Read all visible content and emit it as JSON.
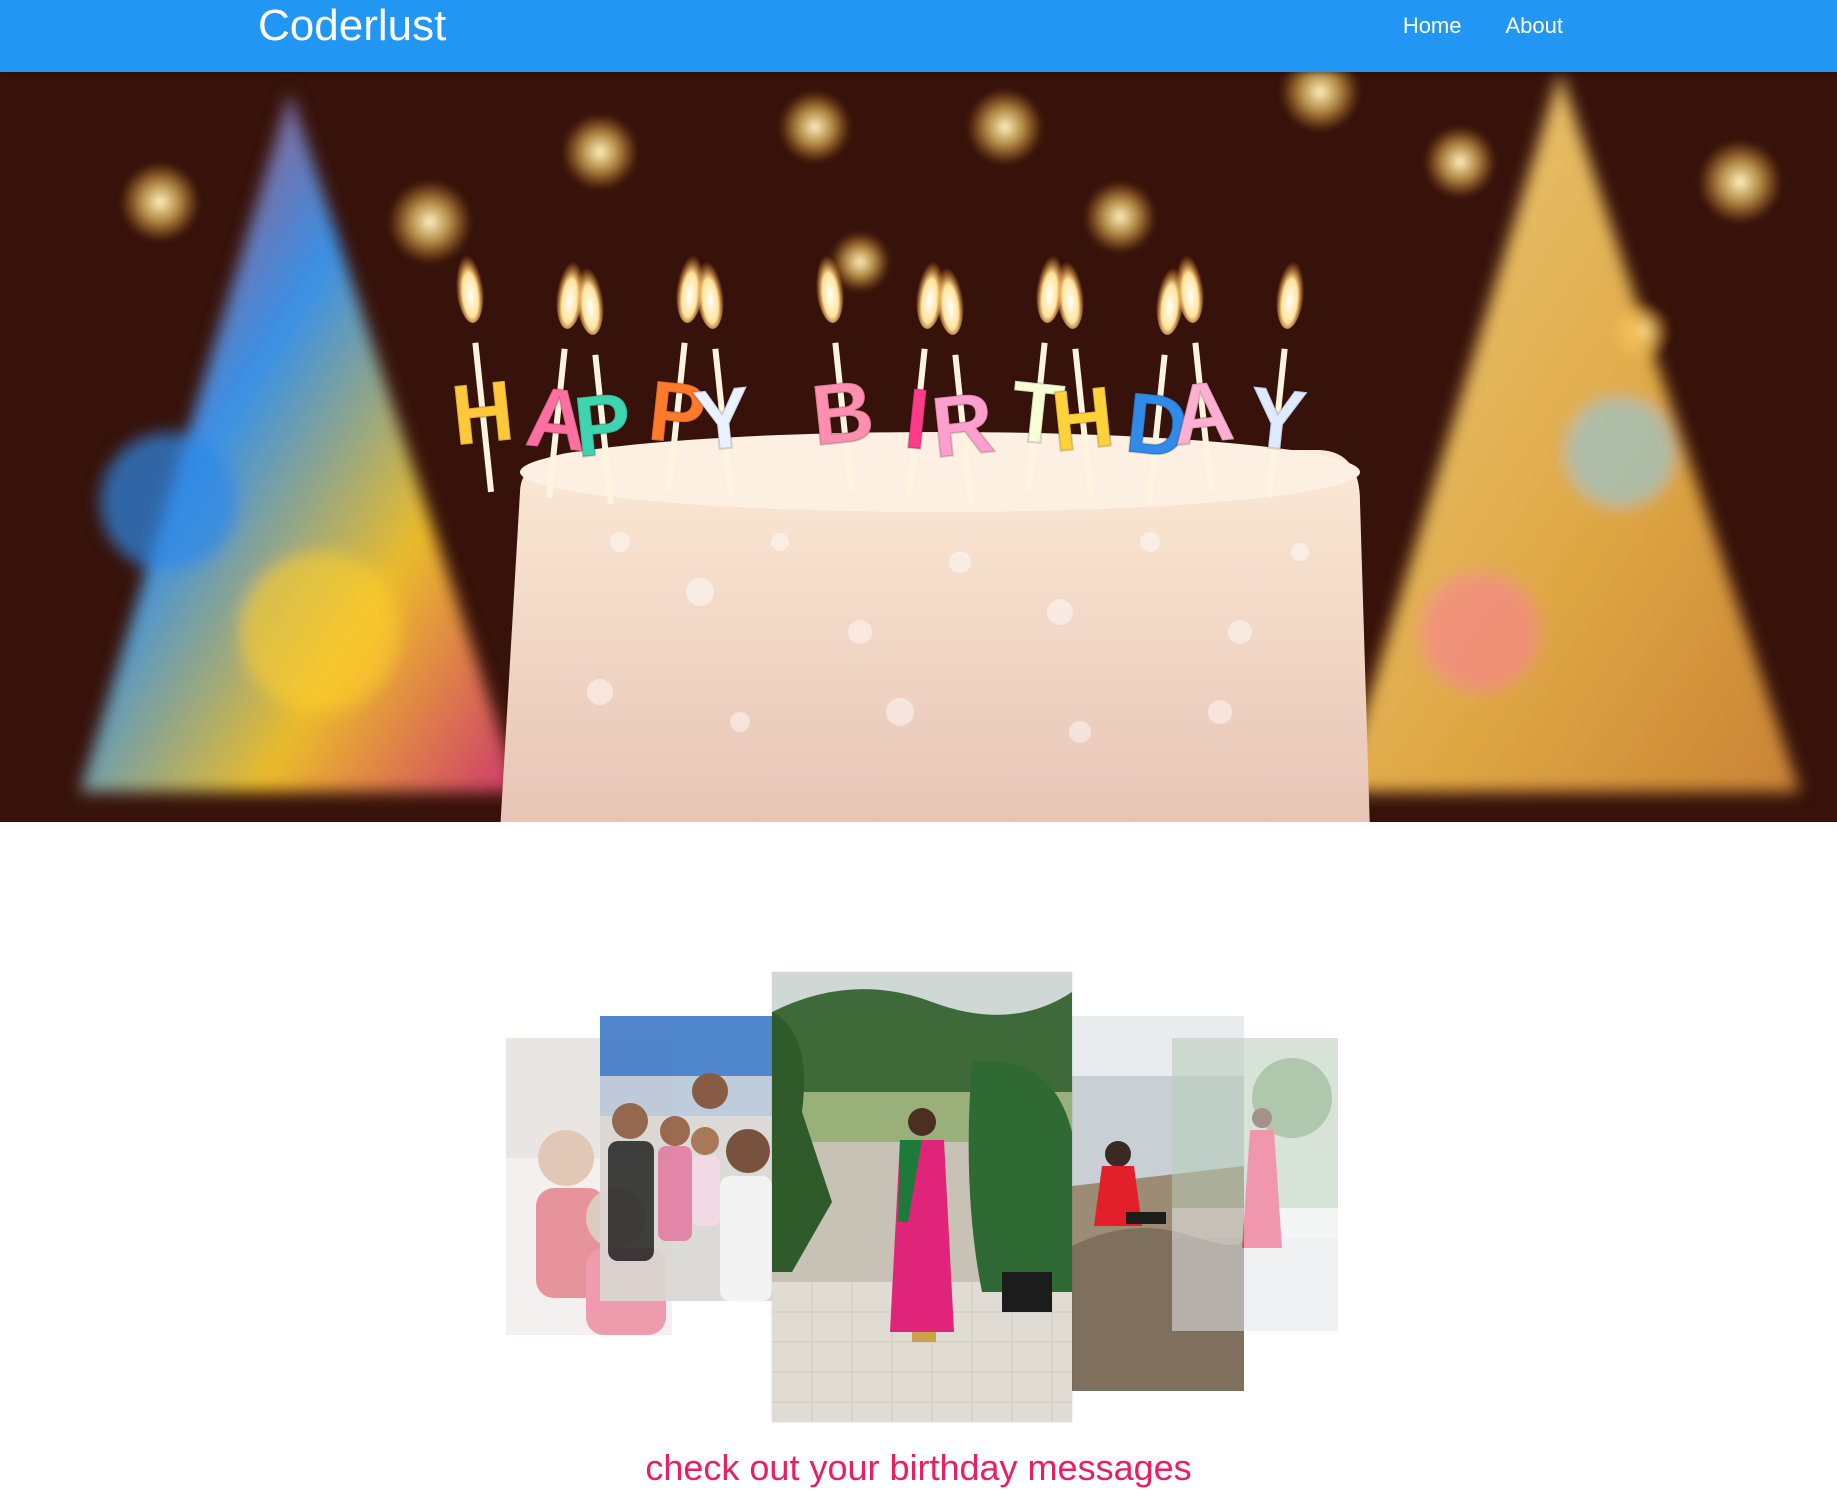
{
  "navbar": {
    "brand": "Coderlust",
    "links": [
      {
        "label": "Home"
      },
      {
        "label": "About"
      }
    ]
  },
  "hero": {
    "image_alt": "Happy birthday cake with candles",
    "candle_letters": [
      "H",
      "A",
      "P",
      "P",
      "Y",
      " ",
      "B",
      "I",
      "R",
      "T",
      "H",
      "D",
      "A",
      "Y"
    ]
  },
  "gallery": {
    "photos": [
      {
        "name": "photo-far-left",
        "alt": "Group photo"
      },
      {
        "name": "photo-left",
        "alt": "Friends selfie"
      },
      {
        "name": "photo-center",
        "alt": "Woman in pink saree"
      },
      {
        "name": "photo-right",
        "alt": "Woman sitting on rocks by water"
      },
      {
        "name": "photo-far-right",
        "alt": "Woman in saree outdoors"
      }
    ]
  },
  "caption": "check out your birthday messages",
  "colors": {
    "navbar": "#2196f3",
    "caption": "#e91e63"
  }
}
